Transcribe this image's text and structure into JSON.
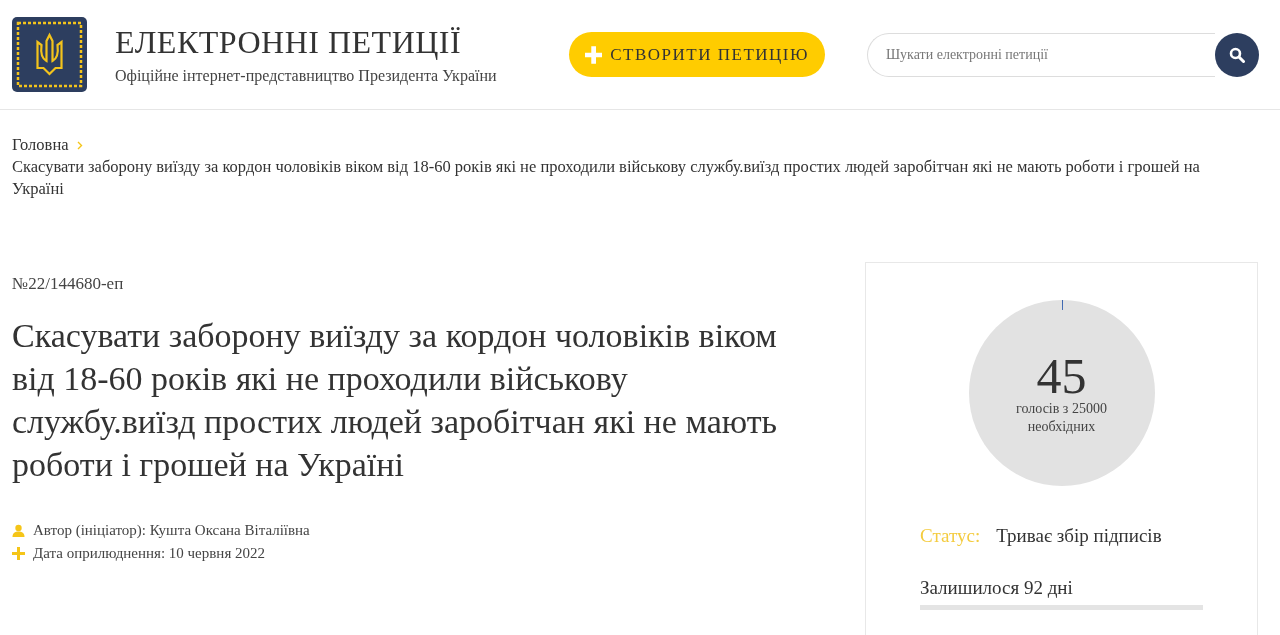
{
  "header": {
    "title": "ЕЛЕКТРОННІ ПЕТИЦІЇ",
    "subtitle": "Офіційне інтернет-представництво Президента України",
    "create_button": "СТВОРИТИ ПЕТИЦІЮ",
    "search": {
      "placeholder": "Шукати електронні петиції"
    }
  },
  "breadcrumb": {
    "home": "Головна",
    "current": "Скасувати заборону виїзду за кордон чоловіків віком від 18-60 років які не проходили військову службу.виїзд простих людей заробітчан які не мають роботи і грошей на Україні"
  },
  "petition": {
    "number": "№22/144680-еп",
    "title": "Скасувати заборону виїзду за кордон чоловіків віком від 18-60 років які не проходили військову службу.виїзд простих людей заробітчан які не мають роботи і грошей на Україні",
    "meta": [
      {
        "kind": "author",
        "text": "Автор (ініціатор): Кушта Оксана Віталіївна"
      },
      {
        "kind": "date",
        "text": "Дата оприлюднення: 10 червня 2022"
      }
    ]
  },
  "votes": {
    "count": "45",
    "caption": "голосів з 25000 необхідних",
    "level": 0.0018,
    "status_label": "Статус:",
    "status": "Триває збір підписів",
    "remaining": "Залишилося 92 дні"
  }
}
